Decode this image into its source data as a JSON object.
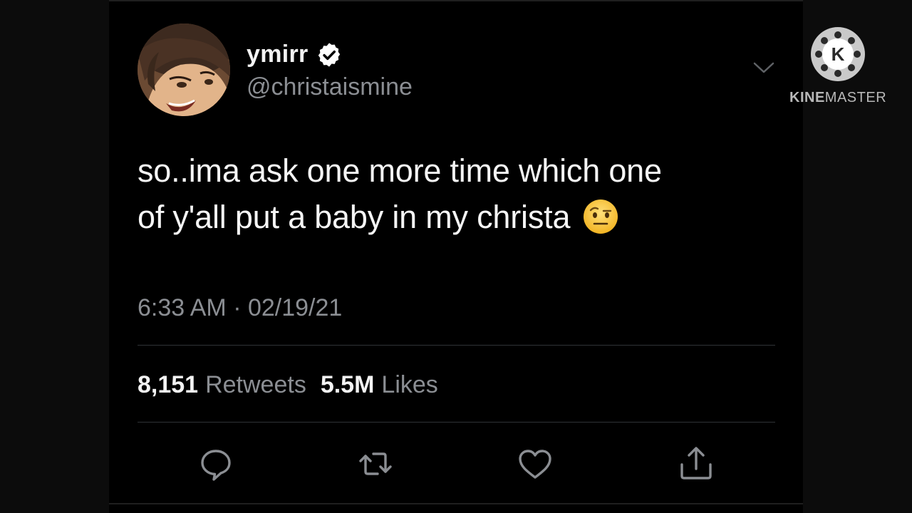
{
  "tweet": {
    "display_name": "ymirr",
    "verified": true,
    "handle": "@christaismine",
    "text_lines": [
      "so..ima ask one more time which one",
      "of y'all put a baby in my christa"
    ],
    "emoji": "raised-eyebrow-face",
    "timestamp": "6:33 AM · 02/19/21",
    "retweets_count": "8,151",
    "retweets_label": "Retweets",
    "likes_count": "5.5M",
    "likes_label": "Likes",
    "actions": [
      "reply-icon",
      "retweet-icon",
      "like-icon",
      "share-icon"
    ],
    "more_icon": "chevron-down-icon"
  },
  "watermark": {
    "bold": "KINE",
    "regular": "MASTER",
    "logo_letter": "K"
  },
  "colors": {
    "background": "#000000",
    "primary_text": "#f3f3f3",
    "secondary_text": "#8b8e93",
    "divider": "#2f3336",
    "verified_badge": "#ffffff"
  }
}
